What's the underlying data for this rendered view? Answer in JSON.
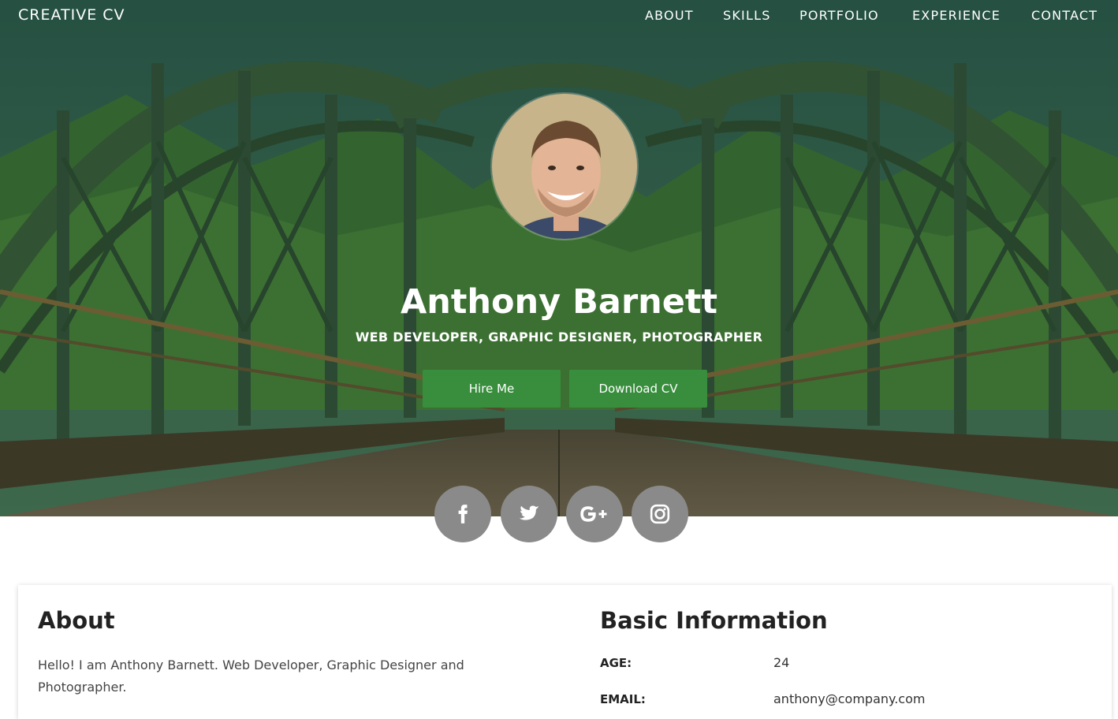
{
  "nav": {
    "brand": "CREATIVE CV",
    "items": [
      {
        "label": "ABOUT"
      },
      {
        "label": "SKILLS"
      },
      {
        "label": "PORTFOLIO"
      },
      {
        "label": "EXPERIENCE"
      },
      {
        "label": "CONTACT"
      }
    ]
  },
  "hero": {
    "name": "Anthony Barnett",
    "subtitle": "WEB DEVELOPER, GRAPHIC DESIGNER, PHOTOGRAPHER",
    "hire_label": "Hire Me",
    "download_label": "Download CV"
  },
  "social": [
    {
      "icon": "facebook-icon"
    },
    {
      "icon": "twitter-icon"
    },
    {
      "icon": "google-plus-icon"
    },
    {
      "icon": "instagram-icon"
    }
  ],
  "about": {
    "title": "About",
    "text": "Hello! I am Anthony Barnett. Web Developer, Graphic Designer and Photographer."
  },
  "basic_info": {
    "title": "Basic Information",
    "rows": [
      {
        "label": "AGE:",
        "value": "24"
      },
      {
        "label": "EMAIL:",
        "value": "anthony@company.com"
      }
    ]
  },
  "colors": {
    "accent": "#388e3c",
    "social_bg": "#8a8a8a"
  }
}
